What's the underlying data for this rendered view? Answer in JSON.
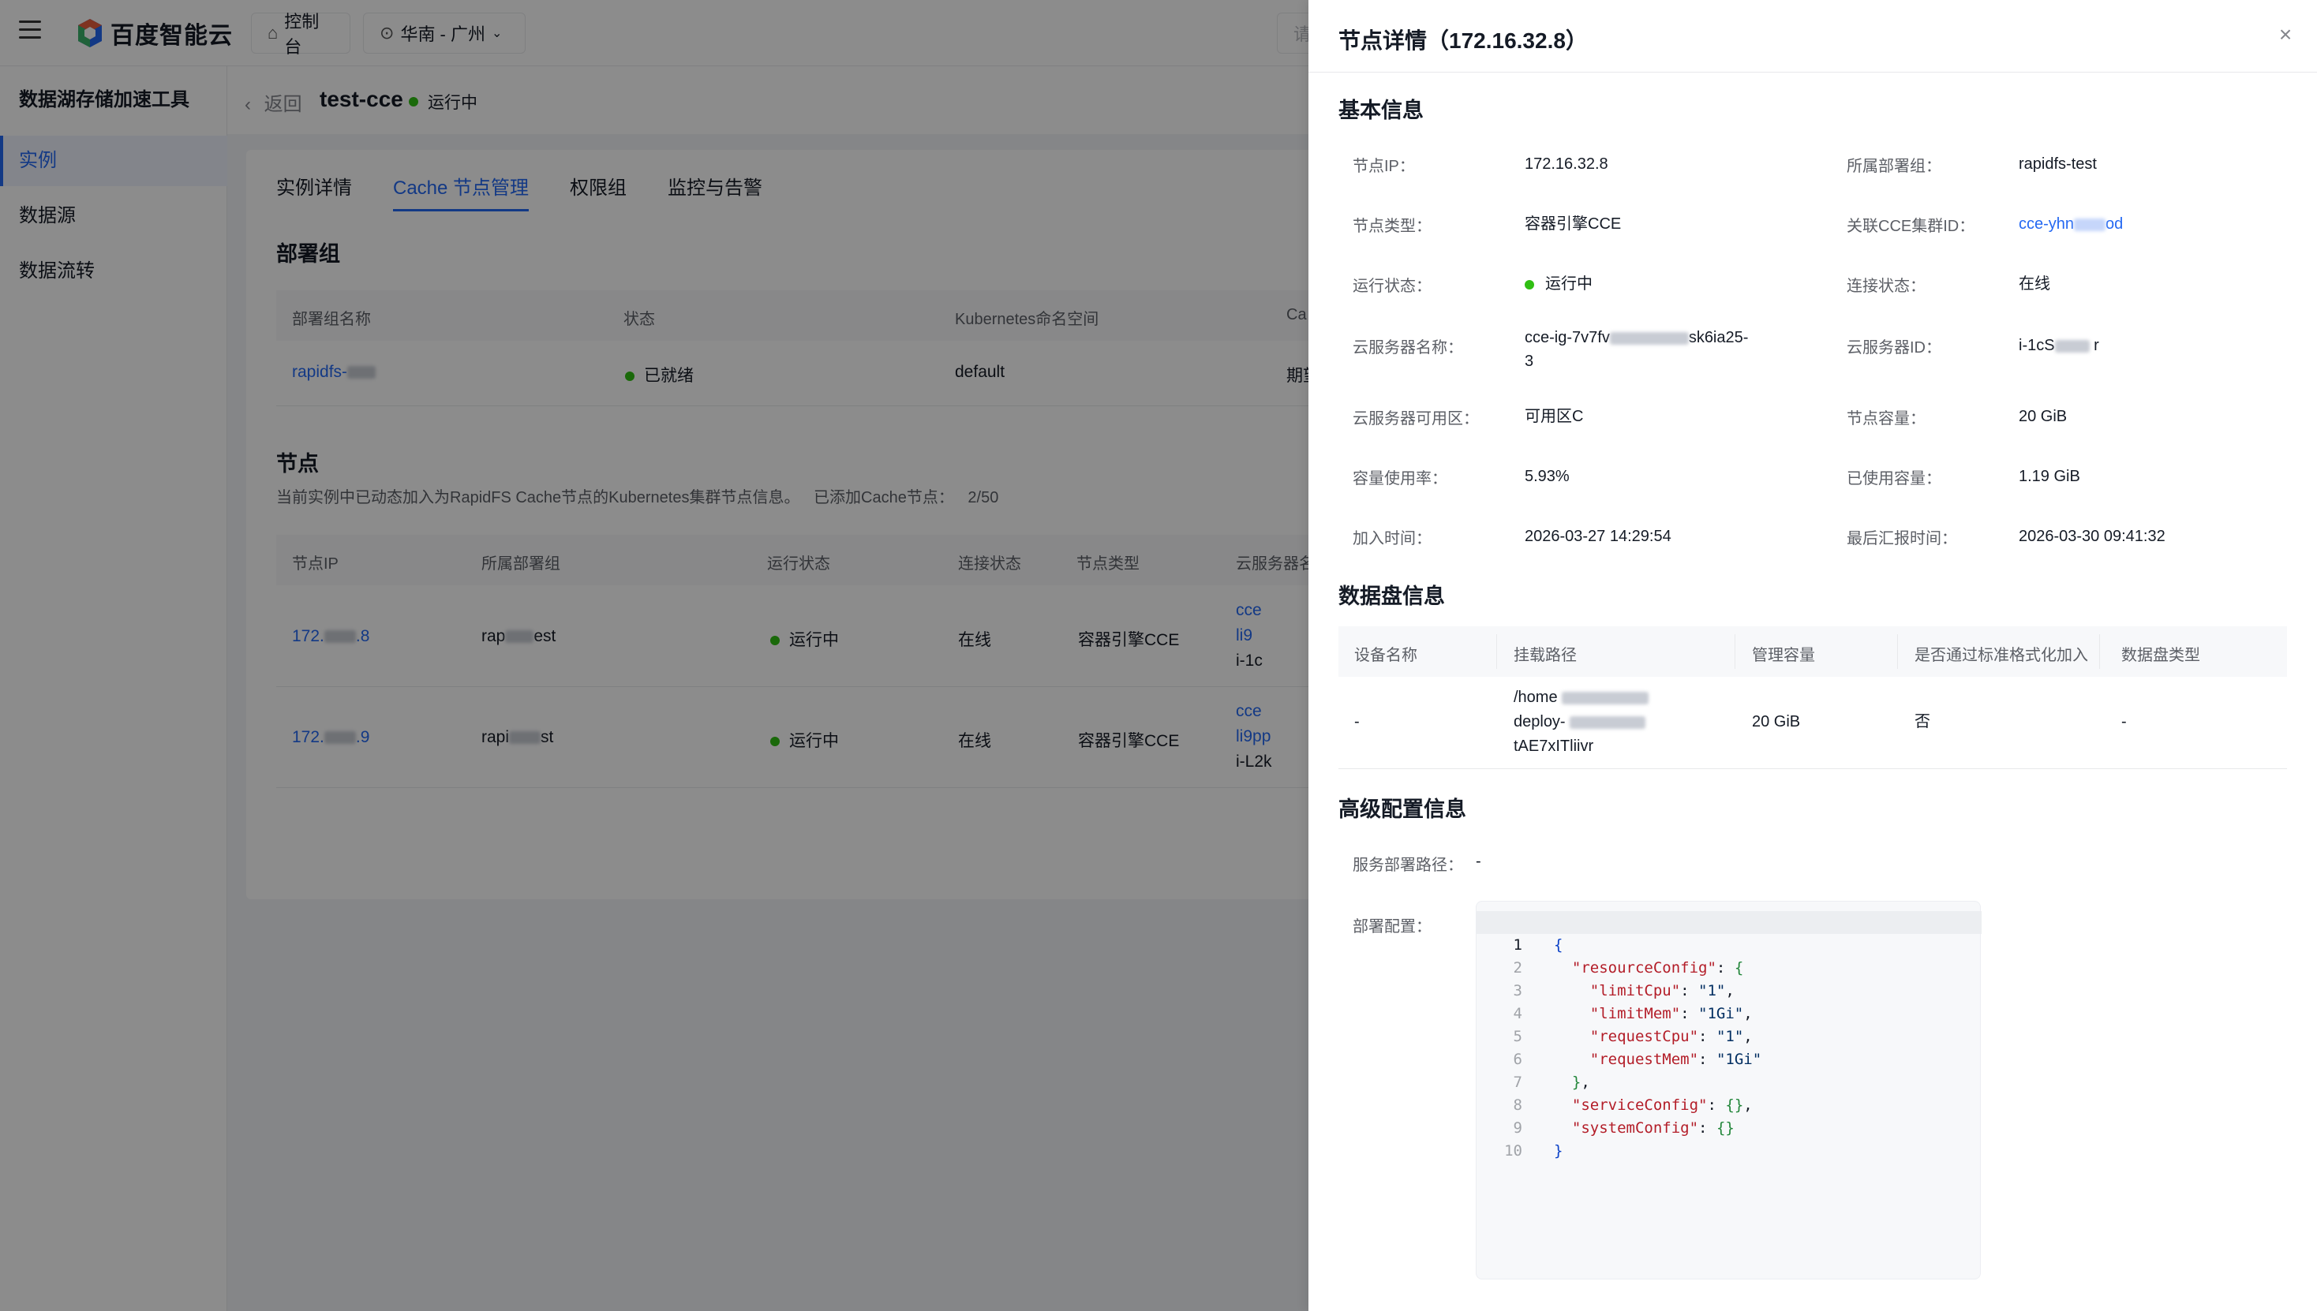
{
  "app": {
    "brand": "百度智能云",
    "console_label": "控制台",
    "region_label": "华南 - 广州",
    "search_placeholder": "请"
  },
  "sidebar": {
    "title": "数据湖存储加速工具",
    "items": [
      {
        "label": "实例"
      },
      {
        "label": "数据源"
      },
      {
        "label": "数据流转"
      }
    ]
  },
  "instance": {
    "back_label": "返回",
    "name": "test-cce",
    "status": "运行中"
  },
  "tabs": [
    {
      "label": "实例详情"
    },
    {
      "label": "Cache 节点管理"
    },
    {
      "label": "权限组"
    },
    {
      "label": "监控与告警"
    }
  ],
  "deploy_group": {
    "section_title": "部署组",
    "columns": [
      "部署组名称",
      "状态",
      "Kubernetes命名空间",
      "Ca"
    ],
    "row": {
      "name": "rapidfs-",
      "status": "已就绪",
      "namespace": "default",
      "extra": "期望"
    }
  },
  "nodes": {
    "section_title": "节点",
    "description": "当前实例中已动态加入为RapidFS Cache节点的Kubernetes集群节点信息。",
    "added_label": "已添加Cache节点：",
    "added_count": "2/50",
    "columns": [
      "节点IP",
      "所属部署组",
      "运行状态",
      "连接状态",
      "节点类型",
      "云服务器名"
    ],
    "rows": [
      {
        "ip_prefix": "172.",
        "ip_suffix": ".8",
        "group_prefix": "rap",
        "group_suffix": "est",
        "status": "运行中",
        "conn": "在线",
        "type": "容器引擎CCE",
        "server": [
          "cce",
          "li9",
          "i-1c"
        ]
      },
      {
        "ip_prefix": "172.",
        "ip_suffix": ".9",
        "group_prefix": "rapi",
        "group_suffix": "st",
        "status": "运行中",
        "conn": "在线",
        "type": "容器引擎CCE",
        "server": [
          "cce",
          "li9pp",
          "i-L2k"
        ]
      }
    ]
  },
  "drawer": {
    "title": "节点详情（172.16.32.8）",
    "basic": {
      "title": "基本信息",
      "fields": {
        "node_ip": {
          "label": "节点IP：",
          "value": "172.16.32.8"
        },
        "deploy_group": {
          "label": "所属部署组：",
          "value": "rapidfs-test"
        },
        "node_type": {
          "label": "节点类型：",
          "value": "容器引擎CCE"
        },
        "cce_cluster": {
          "label": "关联CCE集群ID：",
          "value_prefix": "cce-yhn",
          "value_suffix": "od"
        },
        "run_status": {
          "label": "运行状态：",
          "value": "运行中"
        },
        "conn_status": {
          "label": "连接状态：",
          "value": "在线"
        },
        "server_name": {
          "label": "云服务器名称：",
          "value_prefix": "cce-ig-7v7fv",
          "value_mid": "sk6ia25-",
          "value_suffix": "3"
        },
        "server_id": {
          "label": "云服务器ID：",
          "value_prefix": "i-1cS",
          "value_suffix": "r"
        },
        "zone": {
          "label": "云服务器可用区：",
          "value": "可用区C"
        },
        "capacity": {
          "label": "节点容量：",
          "value": "20 GiB"
        },
        "usage": {
          "label": "容量使用率：",
          "value": "5.93%"
        },
        "used": {
          "label": "已使用容量：",
          "value": "1.19 GiB"
        },
        "join_time": {
          "label": "加入时间：",
          "value": "2026-03-27 14:29:54"
        },
        "report_time": {
          "label": "最后汇报时间：",
          "value": "2026-03-30 09:41:32"
        }
      }
    },
    "disk": {
      "title": "数据盘信息",
      "columns": [
        "设备名称",
        "挂载路径",
        "管理容量",
        "是否通过标准格式化加入",
        "数据盘类型"
      ],
      "row": {
        "device": "-",
        "path_1": "/home",
        "path_2": "deploy-",
        "path_3": "tAE7xITliivr",
        "capacity": "20 GiB",
        "formatted": "否",
        "type": "-"
      }
    },
    "advanced": {
      "title": "高级配置信息",
      "path_label": "服务部署路径：",
      "path_value": "-",
      "config_label": "部署配置：",
      "code_lines": [
        "1",
        "2",
        "3",
        "4",
        "5",
        "6",
        "7",
        "8",
        "9",
        "10"
      ],
      "code": {
        "resourceConfig": "\"resourceConfig\"",
        "limitCpu": "\"limitCpu\"",
        "limitCpu_v": "\"1\"",
        "limitMem": "\"limitMem\"",
        "limitMem_v": "\"1Gi\"",
        "requestCpu": "\"requestCpu\"",
        "requestCpu_v": "\"1\"",
        "requestMem": "\"requestMem\"",
        "requestMem_v": "\"1Gi\"",
        "serviceConfig": "\"serviceConfig\"",
        "systemConfig": "\"systemConfig\""
      }
    }
  }
}
